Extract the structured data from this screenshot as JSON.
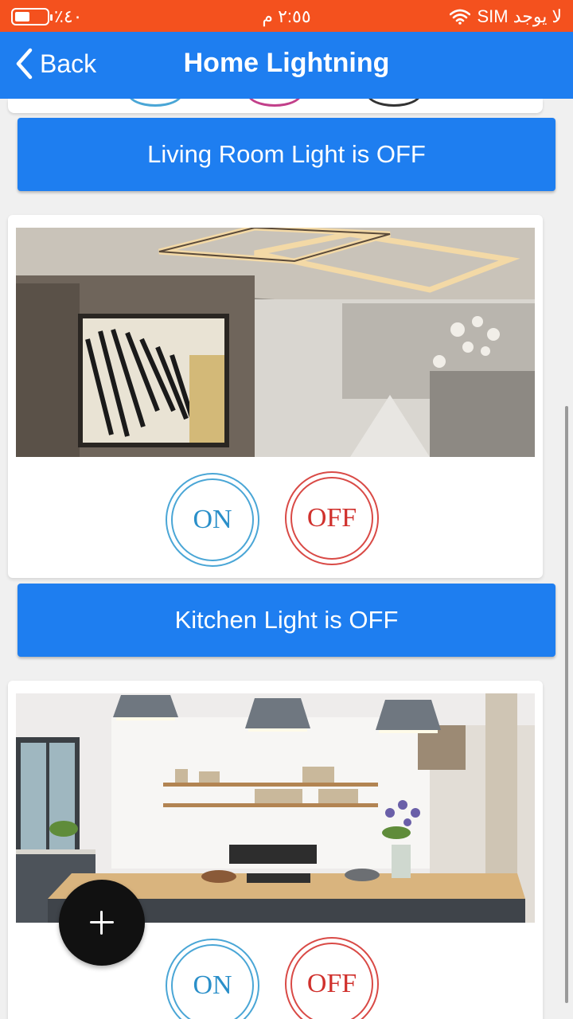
{
  "status_bar": {
    "battery": "٪٤٠",
    "time": "٢:٥٥ م",
    "carrier": "لا يوجد SIM"
  },
  "header": {
    "back_label": "Back",
    "title": "Home Lightning"
  },
  "rooms": [
    {
      "status": "Living Room Light is OFF",
      "on_label": "ON",
      "off_label": "OFF"
    },
    {
      "status": "Kitchen Light is OFF",
      "on_label": "ON",
      "off_label": "OFF"
    }
  ],
  "colors": {
    "status_bar": "#f4511e",
    "primary": "#1e7ef0",
    "on": "#2a8fc9",
    "off": "#d0312d",
    "fab": "#111111"
  }
}
